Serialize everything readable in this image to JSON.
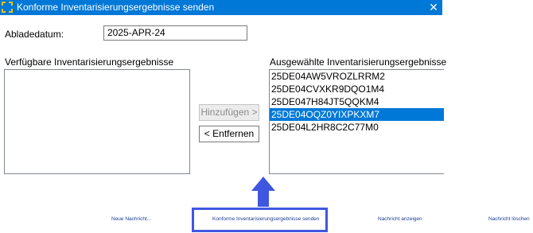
{
  "window": {
    "title": "Konforme Inventarisierungsergebnisse senden",
    "close_icon": "close-icon"
  },
  "form": {
    "date_label": "Abladedatum:",
    "date_value": "2025-APR-24"
  },
  "available": {
    "label": "Verfügbare Inventarisierungsergebnisse",
    "items": []
  },
  "selected_list": {
    "label": "Ausgewählte Inventarisierungsergebnisse",
    "items": [
      "25DE04AW5VROZLRRM2",
      "25DE04CVXKR9DQO1M4",
      "25DE047H84JT5QQKM4",
      "25DE04OQZ0YIXPKXM7",
      "25DE04L2HR8C2C77M0"
    ],
    "selected_item": "25DE04OQZ0YIXPKXM7"
  },
  "buttons": {
    "add": "Hinzufügen >",
    "remove": "< Entfernen"
  },
  "footer": {
    "new_message": "Neue Nachricht...",
    "send_conform": "Konforme Inventarisierungsergebnisse senden",
    "show_message": "Nachricht anzeigen",
    "delete_message": "Nachricht löschen"
  },
  "colors": {
    "titlebar": "#0078d7",
    "selection": "#0078d7",
    "annotation": "#3f57e0"
  }
}
